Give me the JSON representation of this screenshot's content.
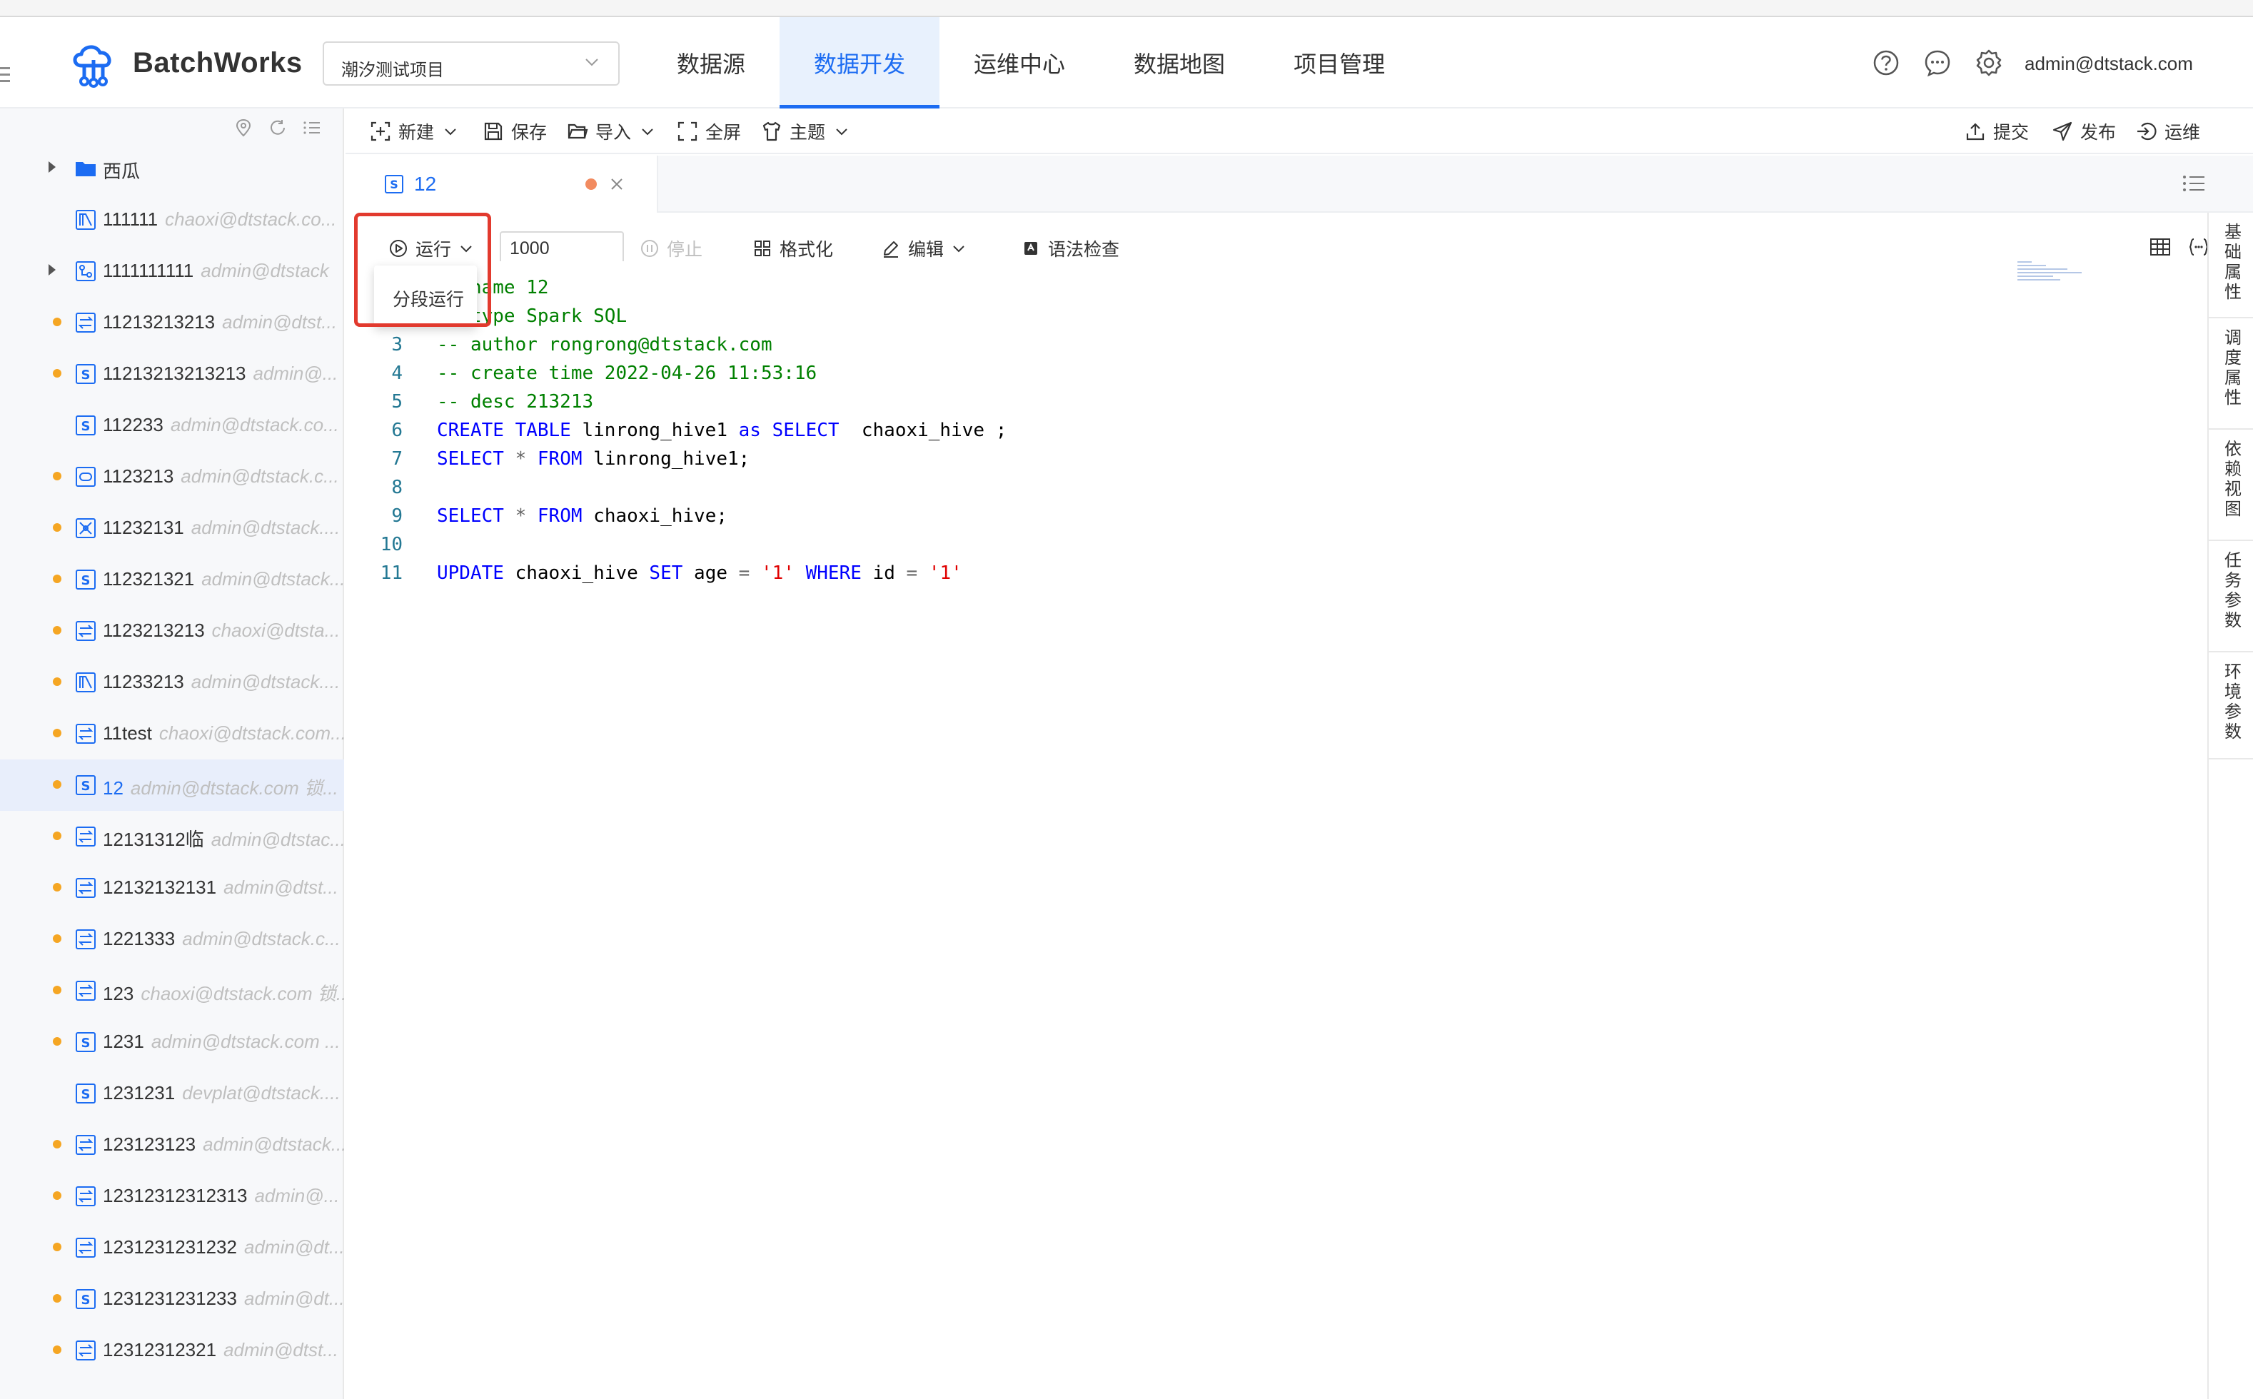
{
  "app": {
    "brand": "BatchWorks",
    "project": "潮汐测试项目",
    "user": "admin@dtstack.com"
  },
  "nav": [
    {
      "label": "数据源",
      "active": false
    },
    {
      "label": "数据开发",
      "active": true
    },
    {
      "label": "运维中心",
      "active": false
    },
    {
      "label": "数据地图",
      "active": false
    },
    {
      "label": "项目管理",
      "active": false
    }
  ],
  "header_icons": [
    "help-circle-icon",
    "message-icon",
    "settings-icon"
  ],
  "toolbar": {
    "new": "新建",
    "save": "保存",
    "import": "导入",
    "fullscreen": "全屏",
    "theme": "主题",
    "submit": "提交",
    "publish": "发布",
    "ops": "运维"
  },
  "tree": [
    {
      "name": "西瓜",
      "owner": "",
      "icon": "folder-icon",
      "dot": false,
      "caret": true
    },
    {
      "name": "111111",
      "owner": "chaoxi@dtstack.co...",
      "icon": "python-task-icon",
      "dot": false,
      "caret": false
    },
    {
      "name": "1111111111",
      "owner": "admin@dtstack",
      "icon": "workflow-icon",
      "dot": false,
      "caret": true
    },
    {
      "name": "11213213213",
      "owner": "admin@dtst...",
      "icon": "sync-task-icon",
      "dot": true,
      "caret": false
    },
    {
      "name": "11213213213213",
      "owner": "admin@...",
      "icon": "sql-task-icon",
      "dot": true,
      "caret": false
    },
    {
      "name": "112233",
      "owner": "admin@dtstack.co...",
      "icon": "sql-task-icon",
      "dot": false,
      "caret": false
    },
    {
      "name": "1123213",
      "owner": "admin@dtstack.c...",
      "icon": "virtual-task-icon",
      "dot": true,
      "caret": false
    },
    {
      "name": "11232131",
      "owner": "admin@dtstack....",
      "icon": "ml-task-icon",
      "dot": true,
      "caret": false
    },
    {
      "name": "112321321",
      "owner": "admin@dtstack...",
      "icon": "sql-task-icon",
      "dot": true,
      "caret": false
    },
    {
      "name": "1123213213",
      "owner": "chaoxi@dtsta...",
      "icon": "sync-task-icon",
      "dot": true,
      "caret": false
    },
    {
      "name": "11233213",
      "owner": "admin@dtstack....",
      "icon": "python-task-icon",
      "dot": true,
      "caret": false
    },
    {
      "name": "11test",
      "owner": "chaoxi@dtstack.com...",
      "icon": "sync-task-icon",
      "dot": true,
      "caret": false
    },
    {
      "name": "12",
      "owner": "admin@dtstack.com 锁...",
      "icon": "sql-task-icon",
      "dot": true,
      "caret": false,
      "selected": true
    },
    {
      "name": "12131312临",
      "owner": "admin@dtstac...",
      "icon": "sync-task-icon",
      "dot": true,
      "caret": false
    },
    {
      "name": "12132132131",
      "owner": "admin@dtst...",
      "icon": "sync-task-icon",
      "dot": true,
      "caret": false
    },
    {
      "name": "1221333",
      "owner": "admin@dtstack.c...",
      "icon": "sync-task-icon",
      "dot": true,
      "caret": false
    },
    {
      "name": "123",
      "owner": "chaoxi@dtstack.com 锁...",
      "icon": "sync-task-icon",
      "dot": true,
      "caret": false
    },
    {
      "name": "1231",
      "owner": "admin@dtstack.com ...",
      "icon": "sql-task-icon",
      "dot": true,
      "caret": false
    },
    {
      "name": "1231231",
      "owner": "devplat@dtstack....",
      "icon": "sql-task-icon",
      "dot": false,
      "caret": false
    },
    {
      "name": "123123123",
      "owner": "admin@dtstack...",
      "icon": "sync-task-icon",
      "dot": true,
      "caret": false
    },
    {
      "name": "12312312312313",
      "owner": "admin@...",
      "icon": "sync-task-icon",
      "dot": true,
      "caret": false
    },
    {
      "name": "1231231231232",
      "owner": "admin@dt...",
      "icon": "sync-task-icon",
      "dot": true,
      "caret": false
    },
    {
      "name": "1231231231233",
      "owner": "admin@dt...",
      "icon": "sql-task-icon",
      "dot": true,
      "caret": false
    },
    {
      "name": "12312312321",
      "owner": "admin@dtst...",
      "icon": "sync-task-icon",
      "dot": true,
      "caret": false
    }
  ],
  "tab": {
    "label": "12"
  },
  "editbar": {
    "run": "运行",
    "limit": "1000",
    "stop": "停止",
    "format": "格式化",
    "edit": "编辑",
    "syntax": "语法检查"
  },
  "dropdown": {
    "segment_run": "分段运行"
  },
  "code_lines": [
    [
      [
        "cm",
        "-- name 12"
      ]
    ],
    [
      [
        "cm",
        "-- type Spark SQL"
      ]
    ],
    [
      [
        "cm",
        "-- author rongrong@dtstack.com"
      ]
    ],
    [
      [
        "cm",
        "-- create time 2022-04-26 11:53:16"
      ]
    ],
    [
      [
        "cm",
        "-- desc 213213"
      ]
    ],
    [
      [
        "kw",
        "CREATE TABLE"
      ],
      [
        "id",
        " linrong_hive1 "
      ],
      [
        "kw",
        "as SELECT"
      ],
      [
        "id",
        "  chaoxi_hive ;"
      ]
    ],
    [
      [
        "kw",
        "SELECT"
      ],
      [
        "op",
        " * "
      ],
      [
        "kw",
        "FROM"
      ],
      [
        "id",
        " linrong_hive1;"
      ]
    ],
    [],
    [
      [
        "kw",
        "SELECT"
      ],
      [
        "op",
        " * "
      ],
      [
        "kw",
        "FROM"
      ],
      [
        "id",
        " chaoxi_hive;"
      ]
    ],
    [],
    [
      [
        "kw",
        "UPDATE"
      ],
      [
        "id",
        " chaoxi_hive "
      ],
      [
        "kw",
        "SET"
      ],
      [
        "id",
        " age "
      ],
      [
        "op",
        "="
      ],
      [
        "id",
        " "
      ],
      [
        "st",
        "'1'"
      ],
      [
        "id",
        " "
      ],
      [
        "kw",
        "WHERE"
      ],
      [
        "id",
        " id "
      ],
      [
        "op",
        "="
      ],
      [
        "id",
        " "
      ],
      [
        "st",
        "'1'"
      ]
    ]
  ],
  "right_panel": [
    "基础属性",
    "调度属性",
    "依赖视图",
    "任务参数",
    "环境参数"
  ]
}
